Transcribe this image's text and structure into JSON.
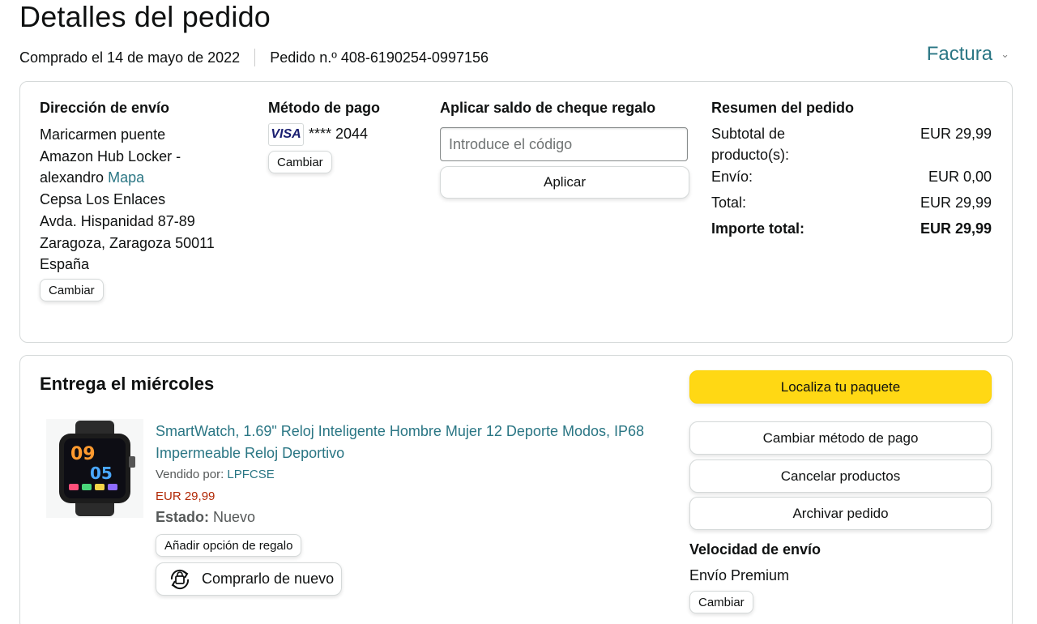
{
  "page": {
    "title": "Detalles del pedido",
    "purchased": "Comprado el 14 de mayo de 2022",
    "order_number": "Pedido n.º 408-6190254-0997156",
    "invoice_label": "Factura"
  },
  "shipping": {
    "heading": "Dirección de envío",
    "name": "Maricarmen puente",
    "line2": "Amazon Hub Locker -",
    "line3_text": "alexandro",
    "map_link": "Mapa",
    "line4": "Cepsa Los Enlaces",
    "line5": "Avda. Hispanidad 87-89",
    "line6": "Zaragoza, Zaragoza 50011",
    "line7": "España",
    "change_label": "Cambiar"
  },
  "payment": {
    "heading": "Método de pago",
    "card_brand": "VISA",
    "card_digits": "**** 2044",
    "change_label": "Cambiar"
  },
  "gift": {
    "heading": "Aplicar saldo de cheque regalo",
    "placeholder": "Introduce el código",
    "apply_label": "Aplicar"
  },
  "summary": {
    "heading": "Resumen del pedido",
    "subtotal_label_1": "Subtotal de",
    "subtotal_label_2": "producto(s):",
    "subtotal_value": "EUR 29,99",
    "shipping_label": "Envío:",
    "shipping_value": "EUR 0,00",
    "total_label": "Total:",
    "total_value": "EUR 29,99",
    "grand_label": "Importe total:",
    "grand_value": "EUR 29,99"
  },
  "delivery": {
    "title": "Entrega el miércoles",
    "product_title": "SmartWatch, 1.69\" Reloj Inteligente Hombre Mujer 12 Deporte Modos, IP68 Impermeable Reloj Deportivo",
    "sold_by_label": "Vendido por:",
    "seller": "LPFCSE",
    "price": "EUR 29,99",
    "state_label": "Estado:",
    "state_value": "Nuevo",
    "gift_option_label": "Añadir opción de regalo",
    "buy_again_label": "Comprarlo de nuevo",
    "watch_time_1": "09",
    "watch_time_2": "05"
  },
  "actions": {
    "track": "Localiza tu paquete",
    "change_payment": "Cambiar método de pago",
    "cancel": "Cancelar productos",
    "archive": "Archivar pedido"
  },
  "speed": {
    "heading": "Velocidad de envío",
    "value": "Envío Premium",
    "change_label": "Cambiar"
  },
  "colors": {
    "link": "#2a7684",
    "price": "#b12704",
    "primary_button": "#ffd814"
  }
}
